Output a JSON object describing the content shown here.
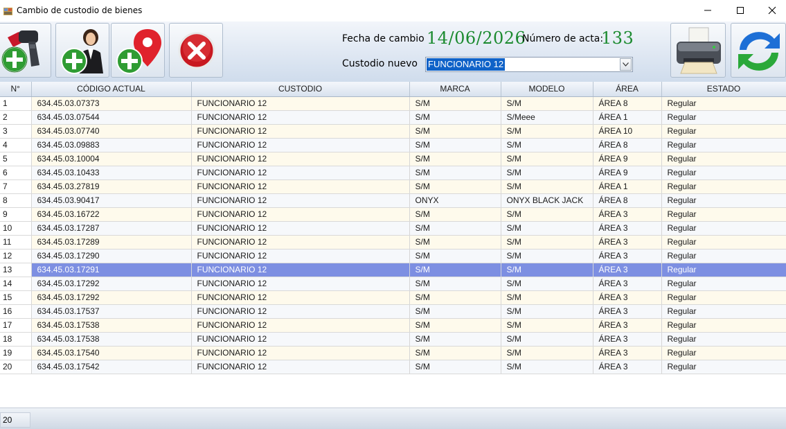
{
  "window": {
    "title": "Cambio de custodio de bienes"
  },
  "form": {
    "fecha_label": "Fecha de cambio",
    "fecha_value": "14/06/2026",
    "acta_label": "Número de acta:",
    "acta_value": "133",
    "custodio_label": "Custodio nuevo",
    "custodio_value": "FUNCIONARIO 12"
  },
  "table": {
    "headers": [
      "N°",
      "CÓDIGO ACTUAL",
      "CUSTODIO",
      "MARCA",
      "MODELO",
      "ÁREA",
      "ESTADO"
    ],
    "selected_row": 13,
    "rows": [
      [
        "1",
        "634.45.03.07373",
        "FUNCIONARIO 12",
        "S/M",
        "S/M",
        "ÁREA 8",
        "Regular"
      ],
      [
        "2",
        "634.45.03.07544",
        "FUNCIONARIO 12",
        "S/M",
        "S/Meee",
        "ÁREA 1",
        "Regular"
      ],
      [
        "3",
        "634.45.03.07740",
        "FUNCIONARIO 12",
        "S/M",
        "S/M",
        "ÁREA 10",
        "Regular"
      ],
      [
        "4",
        "634.45.03.09883",
        "FUNCIONARIO 12",
        "S/M",
        "S/M",
        "ÁREA 8",
        "Regular"
      ],
      [
        "5",
        "634.45.03.10004",
        "FUNCIONARIO 12",
        "S/M",
        "S/M",
        "ÁREA 9",
        "Regular"
      ],
      [
        "6",
        "634.45.03.10433",
        "FUNCIONARIO 12",
        "S/M",
        "S/M",
        "ÁREA 9",
        "Regular"
      ],
      [
        "7",
        "634.45.03.27819",
        "FUNCIONARIO 12",
        "S/M",
        "S/M",
        "ÁREA 1",
        "Regular"
      ],
      [
        "8",
        "634.45.03.90417",
        "FUNCIONARIO 12",
        "ONYX",
        "ONYX BLACK JACK",
        "ÁREA 8",
        "Regular"
      ],
      [
        "9",
        "634.45.03.16722",
        "FUNCIONARIO 12",
        "S/M",
        "S/M",
        "ÁREA 3",
        "Regular"
      ],
      [
        "10",
        "634.45.03.17287",
        "FUNCIONARIO 12",
        "S/M",
        "S/M",
        "ÁREA 3",
        "Regular"
      ],
      [
        "11",
        "634.45.03.17289",
        "FUNCIONARIO 12",
        "S/M",
        "S/M",
        "ÁREA 3",
        "Regular"
      ],
      [
        "12",
        "634.45.03.17290",
        "FUNCIONARIO 12",
        "S/M",
        "S/M",
        "ÁREA 3",
        "Regular"
      ],
      [
        "13",
        "634.45.03.17291",
        "FUNCIONARIO 12",
        "S/M",
        "S/M",
        "ÁREA 3",
        "Regular"
      ],
      [
        "14",
        "634.45.03.17292",
        "FUNCIONARIO 12",
        "S/M",
        "S/M",
        "ÁREA 3",
        "Regular"
      ],
      [
        "15",
        "634.45.03.17292",
        "FUNCIONARIO 12",
        "S/M",
        "S/M",
        "ÁREA 3",
        "Regular"
      ],
      [
        "16",
        "634.45.03.17537",
        "FUNCIONARIO 12",
        "S/M",
        "S/M",
        "ÁREA 3",
        "Regular"
      ],
      [
        "17",
        "634.45.03.17538",
        "FUNCIONARIO 12",
        "S/M",
        "S/M",
        "ÁREA 3",
        "Regular"
      ],
      [
        "18",
        "634.45.03.17538",
        "FUNCIONARIO 12",
        "S/M",
        "S/M",
        "ÁREA 3",
        "Regular"
      ],
      [
        "19",
        "634.45.03.17540",
        "FUNCIONARIO 12",
        "S/M",
        "S/M",
        "ÁREA 3",
        "Regular"
      ],
      [
        "20",
        "634.45.03.17542",
        "FUNCIONARIO 12",
        "S/M",
        "S/M",
        "ÁREA 3",
        "Regular"
      ]
    ]
  },
  "status": {
    "count": "20"
  },
  "toolbar": {
    "icons": [
      "barcode-scanner-add-icon",
      "add-person-icon",
      "add-location-icon",
      "cancel-icon",
      "printer-icon",
      "refresh-icon"
    ]
  },
  "colors": {
    "value_green": "#1b8a2f",
    "selection_blue": "#7d8fe2",
    "combo_highlight": "#0f62c8"
  }
}
